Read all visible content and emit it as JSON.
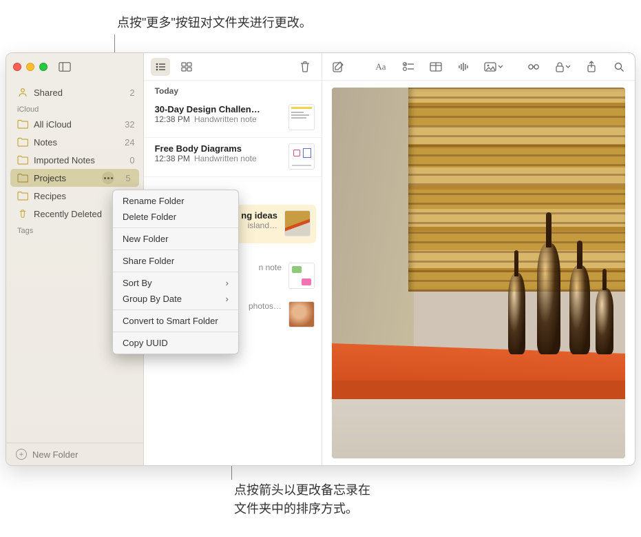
{
  "callouts": {
    "top": "点按\"更多\"按钮对文件夹进行更改。",
    "bottom_l1": "点按箭头以更改备忘录在",
    "bottom_l2": "文件夹中的排序方式。"
  },
  "sidebar": {
    "shared": {
      "label": "Shared",
      "count": "2"
    },
    "sections": {
      "icloud": "iCloud",
      "tags": "Tags"
    },
    "folders": [
      {
        "label": "All iCloud",
        "count": "32"
      },
      {
        "label": "Notes",
        "count": "24"
      },
      {
        "label": "Imported Notes",
        "count": "0"
      },
      {
        "label": "Projects",
        "count": "5"
      },
      {
        "label": "Recipes",
        "count": ""
      },
      {
        "label": "Recently Deleted",
        "count": ""
      }
    ],
    "new_folder": "New Folder"
  },
  "list": {
    "header": "Today",
    "notes": [
      {
        "title": "30-Day Design Challen…",
        "time": "12:38 PM",
        "sub": "Handwritten note"
      },
      {
        "title": "Free Body Diagrams",
        "time": "12:38 PM",
        "sub": "Handwritten note"
      },
      {
        "title": "ng ideas",
        "time": "",
        "sub": "island…"
      },
      {
        "title": "",
        "time": "",
        "sub": "n note"
      },
      {
        "title": "",
        "time": "",
        "sub": "photos…"
      }
    ]
  },
  "context_menu": {
    "rename": "Rename Folder",
    "delete": "Delete Folder",
    "new": "New Folder",
    "share": "Share Folder",
    "sort": "Sort By",
    "group": "Group By Date",
    "convert": "Convert to Smart Folder",
    "copy": "Copy UUID"
  }
}
